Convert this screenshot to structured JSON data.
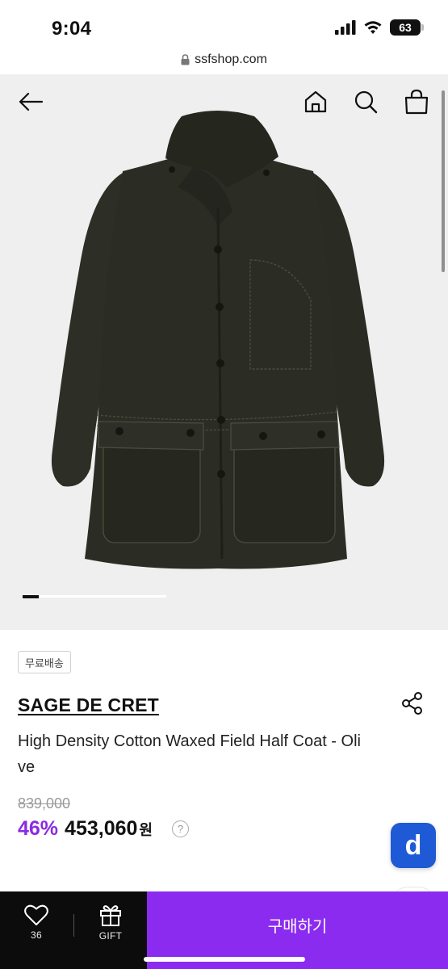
{
  "status_bar": {
    "time": "9:04",
    "battery": "63",
    "icons": [
      "signal-icon",
      "wifi-icon",
      "battery-icon"
    ]
  },
  "browser": {
    "url": "ssfshop.com",
    "icon": "lock-icon"
  },
  "header_nav": {
    "icons": [
      "back-arrow-icon",
      "home-icon",
      "search-icon",
      "shopping-bag-icon"
    ]
  },
  "gallery": {
    "image": "olive-coat-product-photo",
    "pager_position": 1
  },
  "product": {
    "badge": "무료배송",
    "brand": "SAGE DE CRET",
    "name": "High Density Cotton Waxed Field Half Coat - Olive",
    "original_price": "839,000",
    "discount": "46%",
    "sale_price": "453,060",
    "currency": "원",
    "help": "?"
  },
  "floating_button": {
    "label": "d"
  },
  "bottom_bar": {
    "like_count": "36",
    "gift_label": "GIFT",
    "buy_label": "구매하기"
  },
  "colors": {
    "accent": "#8b2bf0",
    "discount": "#8a2be2",
    "bottom_bar": "#0c0c0c",
    "floating": "#1f5ad6",
    "coat": "#2b2d25"
  }
}
